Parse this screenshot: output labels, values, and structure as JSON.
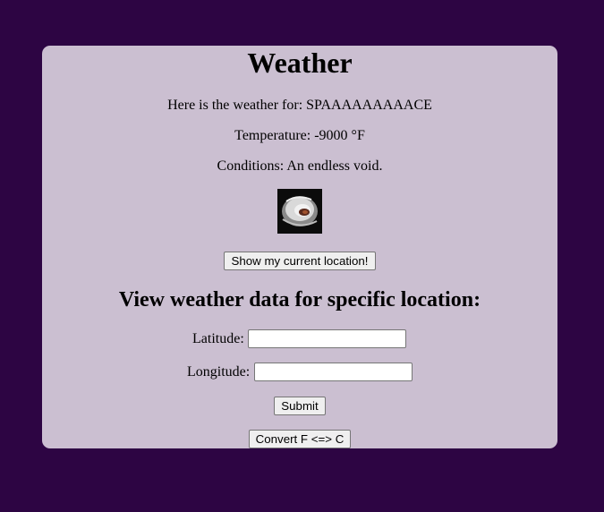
{
  "page": {
    "title": "Weather",
    "location_line": "Here is the weather for: SPAAAAAAAAACE",
    "temperature_line": "Temperature: -9000 °F",
    "conditions_line": "Conditions: An endless void."
  },
  "icon": {
    "name": "weather-condition-icon"
  },
  "buttons": {
    "current_location": "Show my current location!",
    "submit": "Submit",
    "convert": "Convert F <=> C"
  },
  "form": {
    "heading": "View weather data for specific location:",
    "latitude_label": "Latitude:",
    "latitude_value": "",
    "longitude_label": "Longitude:",
    "longitude_value": ""
  },
  "colors": {
    "background": "#2d0543",
    "card": "#cbbfd1"
  }
}
